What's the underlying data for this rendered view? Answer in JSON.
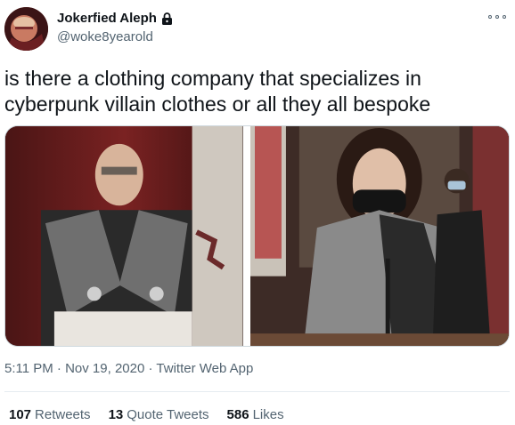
{
  "author": {
    "display_name": "Jokerfied Aleph",
    "handle": "@woke8yearold"
  },
  "tweet": {
    "text": "is there a clothing company that specializes in cyberpunk villain clothes or all they all bespoke"
  },
  "meta": {
    "time": "5:11 PM",
    "date": "Nov 19, 2020",
    "source": "Twitter Web App",
    "separator": "·"
  },
  "stats": {
    "retweets_count": "107",
    "retweets_label": "Retweets",
    "quotes_count": "13",
    "quotes_label": "Quote Tweets",
    "likes_count": "586",
    "likes_label": "Likes"
  },
  "icons": [
    "lock-icon",
    "more-icon"
  ],
  "colors": {
    "text_primary": "#0f1419",
    "text_secondary": "#536471",
    "border": "#cfd9de"
  }
}
